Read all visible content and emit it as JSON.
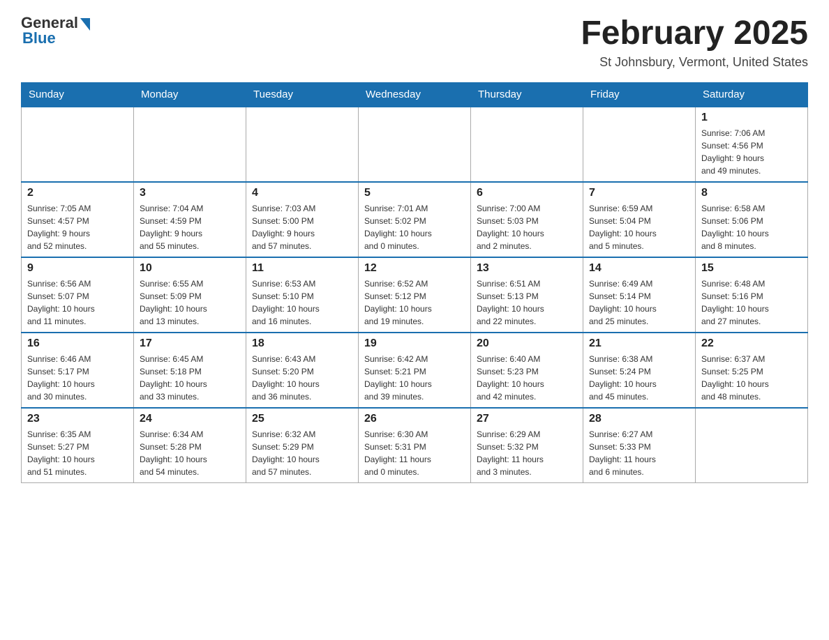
{
  "header": {
    "logo_general": "General",
    "logo_blue": "Blue",
    "month_title": "February 2025",
    "location": "St Johnsbury, Vermont, United States"
  },
  "days_of_week": [
    "Sunday",
    "Monday",
    "Tuesday",
    "Wednesday",
    "Thursday",
    "Friday",
    "Saturday"
  ],
  "weeks": [
    [
      {
        "day": "",
        "info": ""
      },
      {
        "day": "",
        "info": ""
      },
      {
        "day": "",
        "info": ""
      },
      {
        "day": "",
        "info": ""
      },
      {
        "day": "",
        "info": ""
      },
      {
        "day": "",
        "info": ""
      },
      {
        "day": "1",
        "info": "Sunrise: 7:06 AM\nSunset: 4:56 PM\nDaylight: 9 hours\nand 49 minutes."
      }
    ],
    [
      {
        "day": "2",
        "info": "Sunrise: 7:05 AM\nSunset: 4:57 PM\nDaylight: 9 hours\nand 52 minutes."
      },
      {
        "day": "3",
        "info": "Sunrise: 7:04 AM\nSunset: 4:59 PM\nDaylight: 9 hours\nand 55 minutes."
      },
      {
        "day": "4",
        "info": "Sunrise: 7:03 AM\nSunset: 5:00 PM\nDaylight: 9 hours\nand 57 minutes."
      },
      {
        "day": "5",
        "info": "Sunrise: 7:01 AM\nSunset: 5:02 PM\nDaylight: 10 hours\nand 0 minutes."
      },
      {
        "day": "6",
        "info": "Sunrise: 7:00 AM\nSunset: 5:03 PM\nDaylight: 10 hours\nand 2 minutes."
      },
      {
        "day": "7",
        "info": "Sunrise: 6:59 AM\nSunset: 5:04 PM\nDaylight: 10 hours\nand 5 minutes."
      },
      {
        "day": "8",
        "info": "Sunrise: 6:58 AM\nSunset: 5:06 PM\nDaylight: 10 hours\nand 8 minutes."
      }
    ],
    [
      {
        "day": "9",
        "info": "Sunrise: 6:56 AM\nSunset: 5:07 PM\nDaylight: 10 hours\nand 11 minutes."
      },
      {
        "day": "10",
        "info": "Sunrise: 6:55 AM\nSunset: 5:09 PM\nDaylight: 10 hours\nand 13 minutes."
      },
      {
        "day": "11",
        "info": "Sunrise: 6:53 AM\nSunset: 5:10 PM\nDaylight: 10 hours\nand 16 minutes."
      },
      {
        "day": "12",
        "info": "Sunrise: 6:52 AM\nSunset: 5:12 PM\nDaylight: 10 hours\nand 19 minutes."
      },
      {
        "day": "13",
        "info": "Sunrise: 6:51 AM\nSunset: 5:13 PM\nDaylight: 10 hours\nand 22 minutes."
      },
      {
        "day": "14",
        "info": "Sunrise: 6:49 AM\nSunset: 5:14 PM\nDaylight: 10 hours\nand 25 minutes."
      },
      {
        "day": "15",
        "info": "Sunrise: 6:48 AM\nSunset: 5:16 PM\nDaylight: 10 hours\nand 27 minutes."
      }
    ],
    [
      {
        "day": "16",
        "info": "Sunrise: 6:46 AM\nSunset: 5:17 PM\nDaylight: 10 hours\nand 30 minutes."
      },
      {
        "day": "17",
        "info": "Sunrise: 6:45 AM\nSunset: 5:18 PM\nDaylight: 10 hours\nand 33 minutes."
      },
      {
        "day": "18",
        "info": "Sunrise: 6:43 AM\nSunset: 5:20 PM\nDaylight: 10 hours\nand 36 minutes."
      },
      {
        "day": "19",
        "info": "Sunrise: 6:42 AM\nSunset: 5:21 PM\nDaylight: 10 hours\nand 39 minutes."
      },
      {
        "day": "20",
        "info": "Sunrise: 6:40 AM\nSunset: 5:23 PM\nDaylight: 10 hours\nand 42 minutes."
      },
      {
        "day": "21",
        "info": "Sunrise: 6:38 AM\nSunset: 5:24 PM\nDaylight: 10 hours\nand 45 minutes."
      },
      {
        "day": "22",
        "info": "Sunrise: 6:37 AM\nSunset: 5:25 PM\nDaylight: 10 hours\nand 48 minutes."
      }
    ],
    [
      {
        "day": "23",
        "info": "Sunrise: 6:35 AM\nSunset: 5:27 PM\nDaylight: 10 hours\nand 51 minutes."
      },
      {
        "day": "24",
        "info": "Sunrise: 6:34 AM\nSunset: 5:28 PM\nDaylight: 10 hours\nand 54 minutes."
      },
      {
        "day": "25",
        "info": "Sunrise: 6:32 AM\nSunset: 5:29 PM\nDaylight: 10 hours\nand 57 minutes."
      },
      {
        "day": "26",
        "info": "Sunrise: 6:30 AM\nSunset: 5:31 PM\nDaylight: 11 hours\nand 0 minutes."
      },
      {
        "day": "27",
        "info": "Sunrise: 6:29 AM\nSunset: 5:32 PM\nDaylight: 11 hours\nand 3 minutes."
      },
      {
        "day": "28",
        "info": "Sunrise: 6:27 AM\nSunset: 5:33 PM\nDaylight: 11 hours\nand 6 minutes."
      },
      {
        "day": "",
        "info": ""
      }
    ]
  ]
}
